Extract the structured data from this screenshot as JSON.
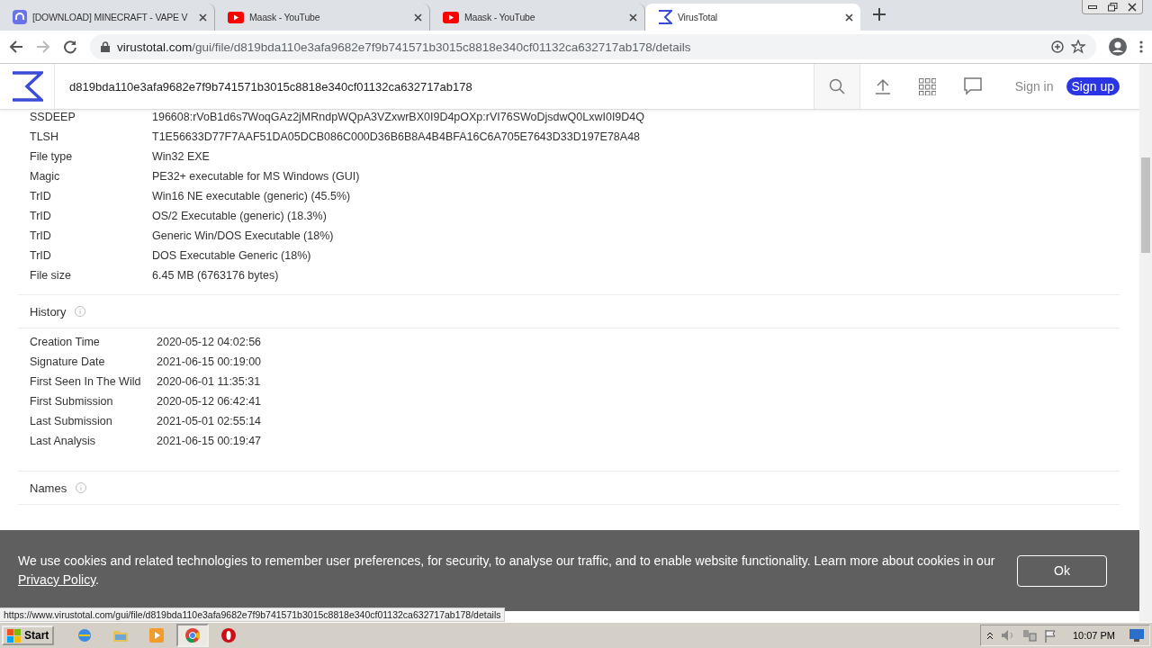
{
  "browser": {
    "tabs": [
      {
        "kind": "site",
        "title": "[DOWNLOAD] MINECRAFT - VAPE V",
        "selected": false
      },
      {
        "kind": "youtube",
        "title": "Maask - YouTube",
        "selected": false
      },
      {
        "kind": "youtube",
        "title": "Maask - YouTube",
        "selected": false
      },
      {
        "kind": "virustotal",
        "title": "VirusTotal",
        "selected": true
      }
    ],
    "address": {
      "host": "virustotal.com",
      "path": "/gui/file/d819bda110e3afa9682e7f9b741571b3015c8818e340cf01132ca632717ab178/details"
    }
  },
  "header": {
    "search_value": "d819bda110e3afa9682e7f9b741571b3015c8818e340cf01132ca632717ab178",
    "sign_in": "Sign in",
    "sign_up": "Sign up"
  },
  "details": [
    {
      "label": "SSDEEP",
      "value": "196608:rVoB1d6s7WoqGAz2jMRndpWQpA3VZxwrBX0I9D4pOXp:rVI76SWoDjsdwQ0LxwI0I9D4Q"
    },
    {
      "label": "TLSH",
      "value": "T1E56633D77F7AAF51DA05DCB086C000D36B6B8A4B4BFA16C6A705E7643D33D197E78A48"
    },
    {
      "label": "File type",
      "value": "Win32 EXE"
    },
    {
      "label": "Magic",
      "value": "PE32+ executable for MS Windows (GUI)"
    },
    {
      "label": "TrID",
      "value": "Win16 NE executable (generic) (45.5%)"
    },
    {
      "label": "TrID",
      "value": "OS/2 Executable (generic) (18.3%)"
    },
    {
      "label": "TrID",
      "value": "Generic Win/DOS Executable (18%)"
    },
    {
      "label": "TrID",
      "value": "DOS Executable Generic (18%)"
    },
    {
      "label": "File size",
      "value": "6.45 MB (6763176 bytes)"
    }
  ],
  "history": {
    "title": "History",
    "rows": [
      {
        "label": "Creation Time",
        "value": "2020-05-12 04:02:56"
      },
      {
        "label": "Signature Date",
        "value": "2021-06-15 00:19:00"
      },
      {
        "label": "First Seen In The Wild",
        "value": "2020-06-01 11:35:31"
      },
      {
        "label": "First Submission",
        "value": "2020-05-12 06:42:41"
      },
      {
        "label": "Last Submission",
        "value": "2021-05-01 02:55:14"
      },
      {
        "label": "Last Analysis",
        "value": "2021-06-15 00:19:47"
      }
    ]
  },
  "names": {
    "title": "Names"
  },
  "cookie_banner": {
    "text": "We use cookies and related technologies to remember user preferences, for security, to analyse our traffic, and to enable website functionality. Learn more about cookies in our",
    "link": "Privacy Policy",
    "tail": ".",
    "button": "Ok"
  },
  "status_url": "https://www.virustotal.com/gui/file/d819bda110e3afa9682e7f9b741571b3015c8818e340cf01132ca632717ab178/details",
  "taskbar": {
    "start": "Start",
    "apps": [
      {
        "kind": "ie",
        "selected": false
      },
      {
        "kind": "folder",
        "selected": false
      },
      {
        "kind": "media",
        "selected": false
      },
      {
        "kind": "chrome",
        "selected": true
      },
      {
        "kind": "opera",
        "selected": false
      }
    ],
    "clock": "10:07 PM"
  }
}
